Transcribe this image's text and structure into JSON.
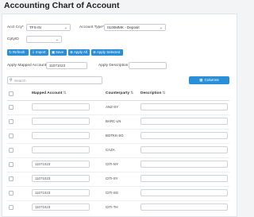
{
  "page": {
    "title": "Accounting Chart of Account"
  },
  "filters": {
    "acct_ccy_label": "Acct Ccy*",
    "acct_ccy_value": "TFS-IN",
    "account_type_label": "Account Type*",
    "account_type_value": "0100MMK - Deposit",
    "cpty_id_label": "CptyID",
    "cpty_id_value": ""
  },
  "toolbar": {
    "refresh": "Refresh",
    "import": "Import",
    "save": "Save",
    "apply_all": "Apply All",
    "apply_selected": "Apply Selected"
  },
  "apply": {
    "mapped_account_label": "Apply Mapped Account",
    "mapped_account_value": "11071023",
    "description_label": "Apply Description",
    "description_value": ""
  },
  "search": {
    "placeholder": "Search"
  },
  "columns_button": "Columns",
  "table": {
    "headers": {
      "mapped_account": "Mapped Account",
      "counterparty": "Counterparty",
      "description": "Description"
    },
    "rows": [
      {
        "mapped_account": "",
        "counterparty": "ANZ-SY",
        "description": ""
      },
      {
        "mapped_account": "",
        "counterparty": "BARC-LN",
        "description": ""
      },
      {
        "mapped_account": "",
        "counterparty": "BOTKK-SG",
        "description": ""
      },
      {
        "mapped_account": "",
        "counterparty": "CAZA",
        "description": ""
      },
      {
        "mapped_account": "11071023",
        "counterparty": "CITI-NY",
        "description": ""
      },
      {
        "mapped_account": "11071023",
        "counterparty": "CITI-SY",
        "description": ""
      },
      {
        "mapped_account": "11071023",
        "counterparty": "CITI-SG",
        "description": ""
      },
      {
        "mapped_account": "11071023",
        "counterparty": "CITI-TH",
        "description": ""
      }
    ]
  },
  "icons": {
    "sort": "sort-icon",
    "search": "search-icon",
    "columns": "columns-icon"
  },
  "colors": {
    "primary": "#2a8fd6"
  }
}
